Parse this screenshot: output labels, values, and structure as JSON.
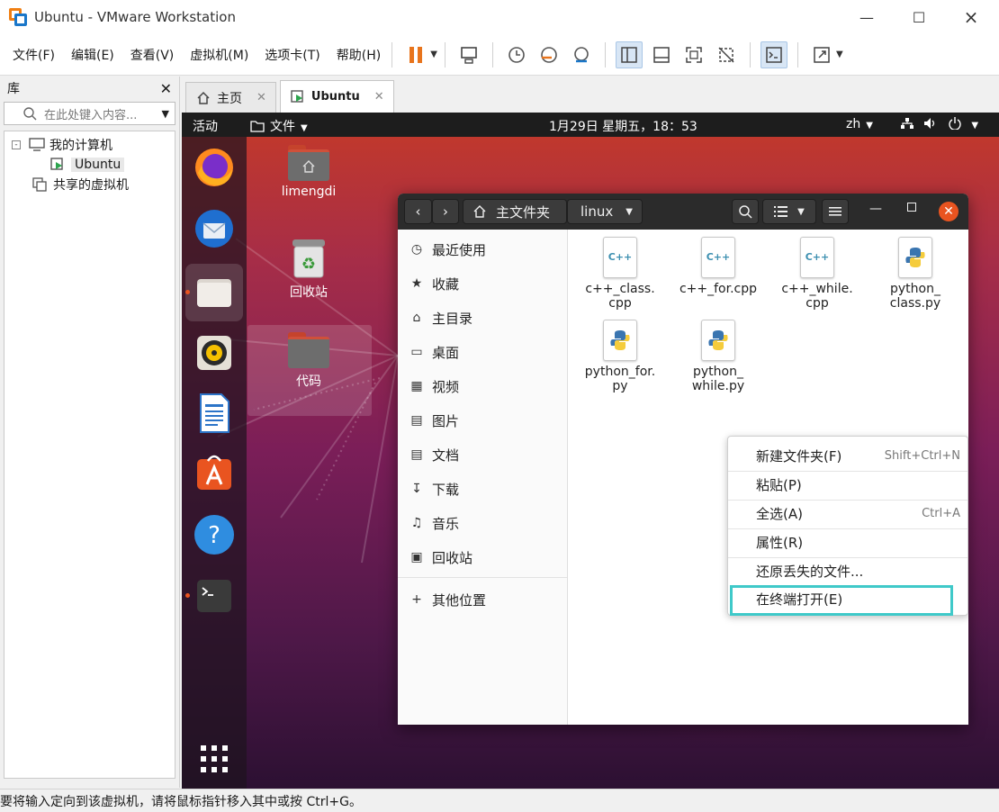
{
  "window": {
    "title": "Ubuntu - VMware Workstation"
  },
  "menu": [
    "文件(F)",
    "编辑(E)",
    "查看(V)",
    "虚拟机(M)",
    "选项卡(T)",
    "帮助(H)"
  ],
  "library": {
    "title": "库",
    "search_placeholder": "在此处键入内容...",
    "tree": {
      "root": "我的计算机",
      "vm": "Ubuntu",
      "shared": "共享的虚拟机"
    }
  },
  "tabs": {
    "home": "主页",
    "vm": "Ubuntu"
  },
  "ubuntu": {
    "topbar": {
      "activities": "活动",
      "app_menu": "文件",
      "clock": "1月29日 星期五，18：53",
      "input_method": "zh"
    },
    "desktop": {
      "home_folder": "limengdi",
      "trash": "回收站",
      "code_folder": "代码"
    },
    "files": {
      "path": [
        "主文件夹",
        "linux"
      ],
      "sidebar": [
        "最近使用",
        "收藏",
        "主目录",
        "桌面",
        "视频",
        "图片",
        "文档",
        "下载",
        "音乐",
        "回收站",
        "其他位置"
      ],
      "files": [
        {
          "name": "c++_class.\ncpp",
          "type": "cpp",
          "icon_text": "C++"
        },
        {
          "name": "c++_for.cpp",
          "type": "cpp",
          "icon_text": "C++"
        },
        {
          "name": "c++_while.\ncpp",
          "type": "cpp",
          "icon_text": "C++"
        },
        {
          "name": "python_\nclass.py",
          "type": "py"
        },
        {
          "name": "python_for.\npy",
          "type": "py"
        },
        {
          "name": "python_\nwhile.py",
          "type": "py"
        }
      ]
    },
    "context_menu": [
      {
        "label": "新建文件夹(F)",
        "shortcut": "Shift+Ctrl+N"
      },
      {
        "label": "粘贴(P)",
        "shortcut": ""
      },
      {
        "label": "全选(A)",
        "shortcut": "Ctrl+A"
      },
      {
        "label": "属性(R)",
        "shortcut": ""
      },
      {
        "label": "还原丢失的文件...",
        "shortcut": ""
      },
      {
        "label": "在终端打开(E)",
        "shortcut": ""
      }
    ]
  },
  "status_bar": "要将输入定向到该虚拟机，请将鼠标指针移入其中或按 Ctrl+G。",
  "colors": {
    "accent": "#e95420",
    "highlight_box": "#3fc9c9",
    "vmware_orange": "#f07f13",
    "vmware_blue": "#1a77c9"
  }
}
